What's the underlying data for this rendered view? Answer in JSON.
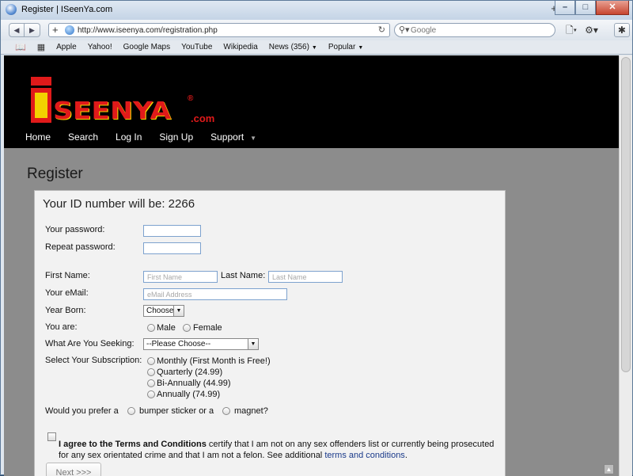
{
  "window": {
    "title": "Register | ISeenYa.com"
  },
  "browser": {
    "url": "http://www.iseenya.com/registration.php",
    "search_placeholder": "Google",
    "bookmarks": [
      "Apple",
      "Yahoo!",
      "Google Maps",
      "YouTube",
      "Wikipedia",
      "News (356)",
      "Popular"
    ]
  },
  "site": {
    "logo_word": "SEENYA",
    "logo_com": ".com",
    "logo_reg": "®",
    "nav": [
      "Home",
      "Search",
      "Log In",
      "Sign Up",
      "Support"
    ]
  },
  "page": {
    "title": "Register",
    "id_heading": "Your ID number will be: 2266"
  },
  "form": {
    "password_label": "Your password:",
    "repeat_password_label": "Repeat password:",
    "first_name_label": "First Name:",
    "first_name_placeholder": "First Name",
    "last_name_label": "Last Name:",
    "last_name_placeholder": "Last Name",
    "email_label": "Your eMail:",
    "email_placeholder": "eMail Address",
    "year_born_label": "Year Born:",
    "year_born_value": "Choose",
    "you_are_label": "You are:",
    "gender_options": [
      "Male",
      "Female"
    ],
    "seeking_label": "What Are You Seeking:",
    "seeking_value": "--Please Choose--",
    "subscription_label": "Select Your Subscription:",
    "subscription_options": [
      "Monthly (First Month is Free!)",
      "Quarterly (24.99)",
      "Bi-Annually (44.99)",
      "Annually (74.99)"
    ],
    "prefer_label": "Would you prefer a",
    "prefer_option_1": "bumper sticker or a",
    "prefer_option_2": "magnet?",
    "agree_bold": "I agree to the Terms and Conditions",
    "agree_text": " certify that I am not on any sex offenders list or currently being prosecuted for any sex orientated crime and that I am not a felon. See additional ",
    "agree_link": "terms and conditions",
    "next_label": "Next >>>"
  }
}
